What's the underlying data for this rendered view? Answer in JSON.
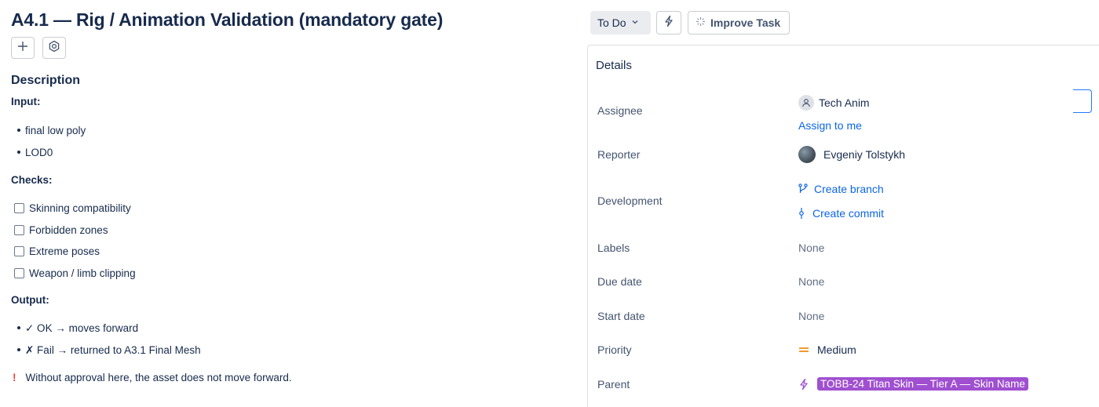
{
  "issue": {
    "title": "A4.1 — Rig / Animation Validation (mandatory gate)",
    "add_icon": "plus-icon",
    "settings_icon": "gear-icon"
  },
  "description": {
    "heading": "Description",
    "input_heading": "Input:",
    "input_items": [
      "final low poly",
      "LOD0"
    ],
    "checks_heading": "Checks:",
    "checks": [
      "Skinning compatibility",
      "Forbidden zones",
      "Extreme poses",
      "Weapon / limb clipping"
    ],
    "output_heading": "Output:",
    "output_items": [
      "✓ OK → moves forward",
      "✗ Fail → returned to A3.1 Final Mesh"
    ],
    "warning_mark": "!",
    "warning": "Without approval here, the asset does not move forward."
  },
  "toolbar": {
    "status": "To Do",
    "improve": "Improve Task"
  },
  "details": {
    "heading": "Details",
    "assignee_label": "Assignee",
    "assignee": "Tech Anim",
    "assign_to_me": "Assign to me",
    "reporter_label": "Reporter",
    "reporter": "Evgeniy Tolstykh",
    "development_label": "Development",
    "create_branch": "Create branch",
    "create_commit": "Create commit",
    "labels_label": "Labels",
    "labels": "None",
    "due_label": "Due date",
    "due": "None",
    "start_label": "Start date",
    "start": "None",
    "priority_label": "Priority",
    "priority": "Medium",
    "parent_label": "Parent",
    "parent": "TOBB-24 Titan Skin — Tier A — Skin Name"
  },
  "colors": {
    "link": "#0c66e4",
    "priority_medium": "#f18d13",
    "parent_tag": "#9f4fd0",
    "warning": "#e2483d"
  }
}
